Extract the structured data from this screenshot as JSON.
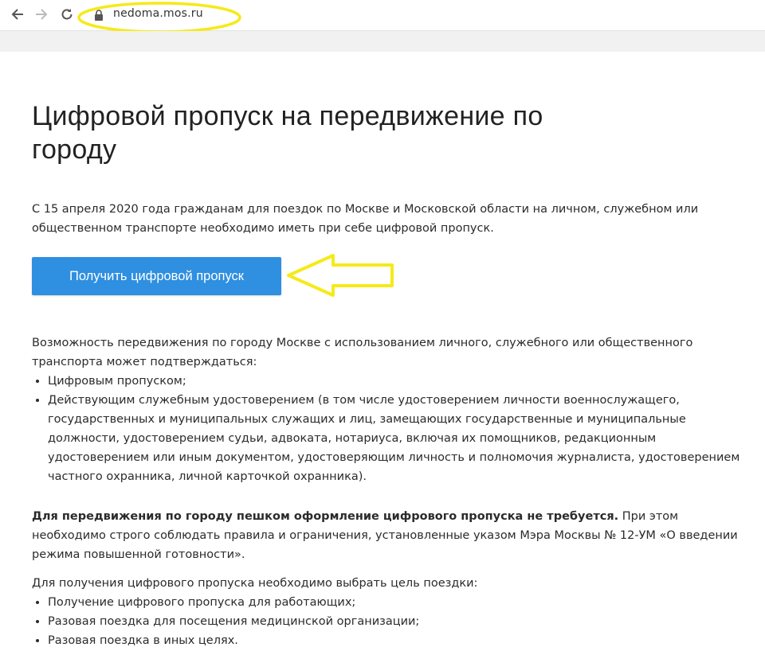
{
  "browser": {
    "url": "nedoma.mos.ru",
    "back_icon": "back-arrow-icon",
    "forward_icon": "forward-arrow-icon",
    "reload_icon": "reload-icon",
    "lock_icon": "lock-icon",
    "annotation_color": "#f5ea1a"
  },
  "page": {
    "title": "Цифровой пропуск на передвижение по городу",
    "intro": "С 15 апреля 2020 года гражданам для поездок по Москве и Московской области на личном, служебном или общественном транспорте необходимо иметь при себе цифровой пропуск.",
    "cta_label": "Получить цифровой пропуск",
    "cta_color": "#2f8fe0",
    "confirm_text": "Возможность передвижения по городу Москве с использованием личного, служебного или общественного транспорта может подтверждаться:",
    "confirm_items": [
      "Цифровым пропуском;",
      "Действующим служебным удостоверением (в том числе удостоверением личности военнослужащего, государственных и муниципальных служащих и лиц, замещающих государственные и муниципальные должности, удостоверением судьи, адвоката, нотариуса, включая их помощников, редакционным удостоверением или иным документом, удостоверяющим личность и полномочия журналиста, удостоверением частного охранника, личной карточкой охранника)."
    ],
    "walking_bold": "Для передвижения по городу пешком оформление цифрового пропуска не требуется.",
    "walking_rest": " При этом необходимо строго соблюдать правила и ограничения, установленные указом Мэра Москвы № 12-УМ «О введении режима повышенной готовности».",
    "purpose_text": "Для получения цифрового пропуска необходимо выбрать цель поездки:",
    "purpose_items": [
      "Получение цифрового пропуска для работающих;",
      "Разовая поездка для посещения медицинской организации;",
      "Разовая поездка в иных целях."
    ]
  }
}
